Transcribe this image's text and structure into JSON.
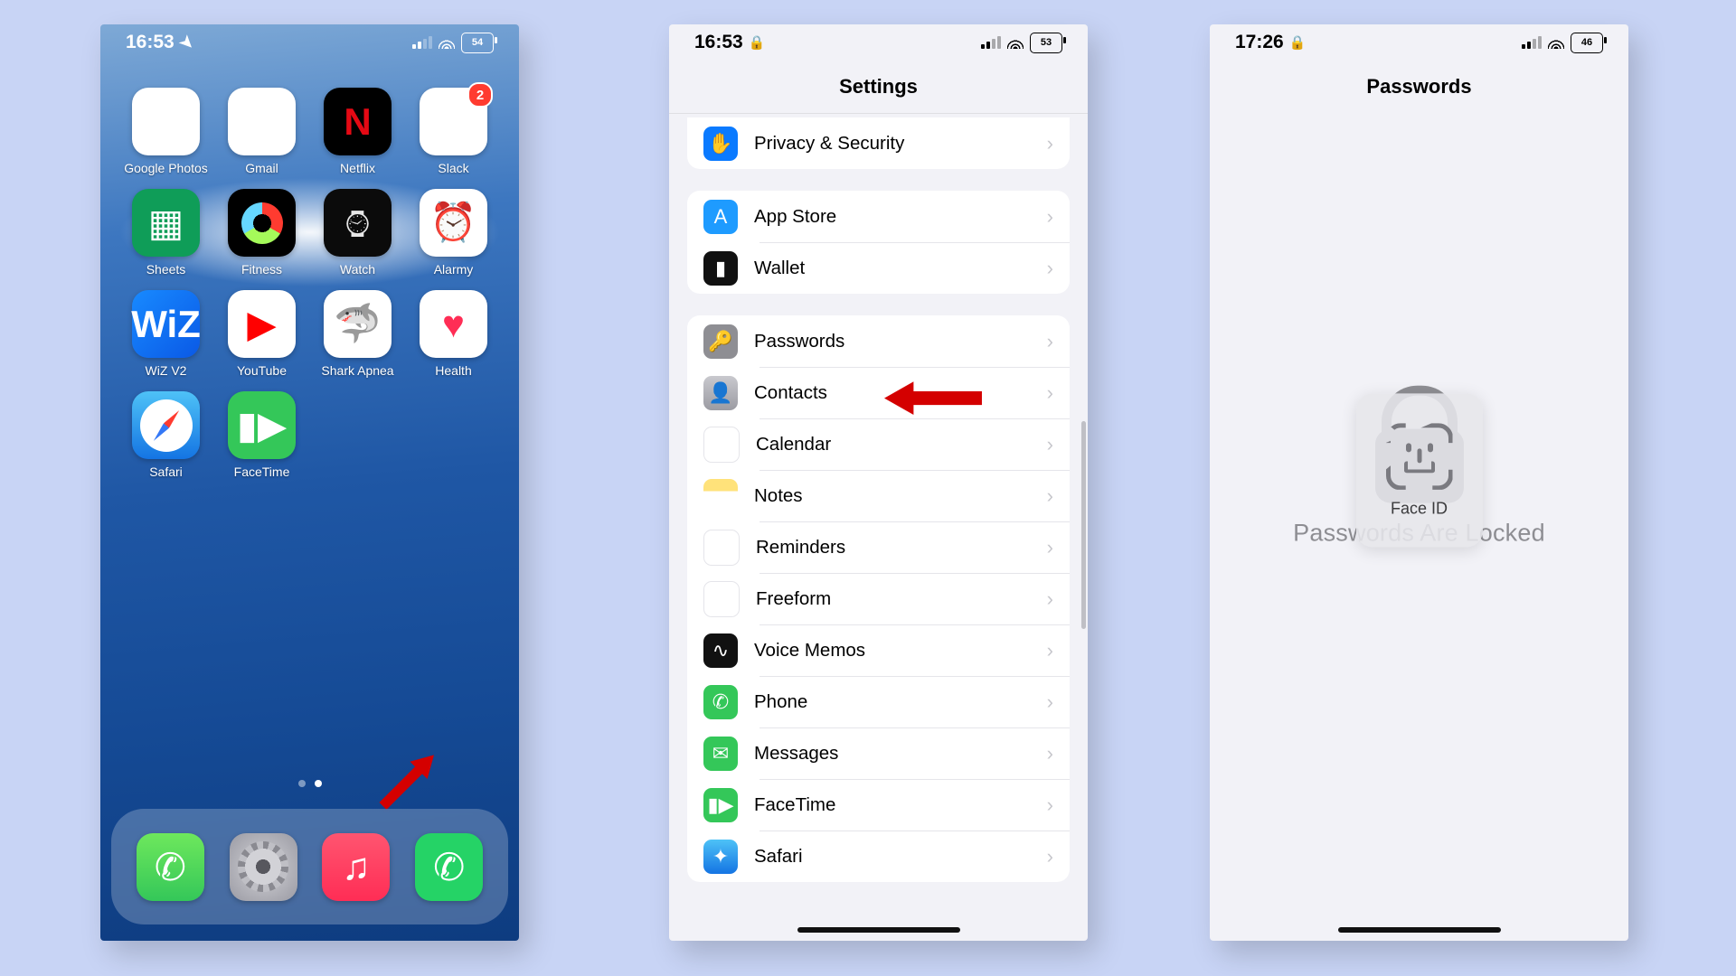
{
  "phone1": {
    "status": {
      "time": "16:53",
      "battery": "54"
    },
    "apps": [
      {
        "name": "Google Photos",
        "cls": "ic-gphotos",
        "glyph": "✦"
      },
      {
        "name": "Gmail",
        "cls": "ic-gmail",
        "glyph": "✉︎"
      },
      {
        "name": "Netflix",
        "cls": "ic-netflix",
        "glyph": "N"
      },
      {
        "name": "Slack",
        "cls": "ic-slack",
        "glyph": "✱",
        "badge": "2"
      },
      {
        "name": "Sheets",
        "cls": "ic-sheets",
        "glyph": "▦"
      },
      {
        "name": "Fitness",
        "cls": "ic-fitness",
        "glyph": "ring"
      },
      {
        "name": "Watch",
        "cls": "ic-watch",
        "glyph": "⌚︎"
      },
      {
        "name": "Alarmy",
        "cls": "ic-alarmy",
        "glyph": "⏰"
      },
      {
        "name": "WiZ V2",
        "cls": "ic-wiz",
        "glyph": "WiZ"
      },
      {
        "name": "YouTube",
        "cls": "ic-youtube",
        "glyph": "▶"
      },
      {
        "name": "Shark Apnea",
        "cls": "ic-shark",
        "glyph": "🦈"
      },
      {
        "name": "Health",
        "cls": "ic-health",
        "glyph": "♥"
      },
      {
        "name": "Safari",
        "cls": "ic-safari",
        "glyph": "compass"
      },
      {
        "name": "FaceTime",
        "cls": "ic-facetime",
        "glyph": "▮▶"
      }
    ],
    "dock": [
      {
        "name": "Phone",
        "cls": "ic-phone",
        "glyph": "✆"
      },
      {
        "name": "Settings",
        "cls": "ic-settings",
        "glyph": "gear"
      },
      {
        "name": "Music",
        "cls": "ic-music",
        "glyph": "♫"
      },
      {
        "name": "WhatsApp",
        "cls": "ic-whatsapp",
        "glyph": "✆"
      }
    ]
  },
  "phone2": {
    "status": {
      "time": "16:53",
      "battery": "53"
    },
    "title": "Settings",
    "groups": [
      [
        {
          "label": "Privacy & Security",
          "icon": "si-privacy",
          "glyph": "✋"
        }
      ],
      [
        {
          "label": "App Store",
          "icon": "si-appstore",
          "glyph": "A"
        },
        {
          "label": "Wallet",
          "icon": "si-wallet",
          "glyph": "▮"
        }
      ],
      [
        {
          "label": "Passwords",
          "icon": "si-passwords",
          "glyph": "🔑",
          "highlight": true
        },
        {
          "label": "Contacts",
          "icon": "si-contacts",
          "glyph": "👤"
        },
        {
          "label": "Calendar",
          "icon": "si-calendar",
          "glyph": "▦"
        },
        {
          "label": "Notes",
          "icon": "si-notes",
          "glyph": ""
        },
        {
          "label": "Reminders",
          "icon": "si-reminders",
          "glyph": "⋮"
        },
        {
          "label": "Freeform",
          "icon": "si-freeform",
          "glyph": "✎"
        },
        {
          "label": "Voice Memos",
          "icon": "si-voicememos",
          "glyph": "∿"
        },
        {
          "label": "Phone",
          "icon": "si-phone",
          "glyph": "✆"
        },
        {
          "label": "Messages",
          "icon": "si-messages",
          "glyph": "✉︎"
        },
        {
          "label": "FaceTime",
          "icon": "si-facetime",
          "glyph": "▮▶"
        },
        {
          "label": "Safari",
          "icon": "si-safari",
          "glyph": "✦"
        }
      ]
    ]
  },
  "phone3": {
    "status": {
      "time": "17:26",
      "battery": "46"
    },
    "title": "Passwords",
    "locked_text": "Passwords Are Locked",
    "faceid_label": "Face ID"
  }
}
